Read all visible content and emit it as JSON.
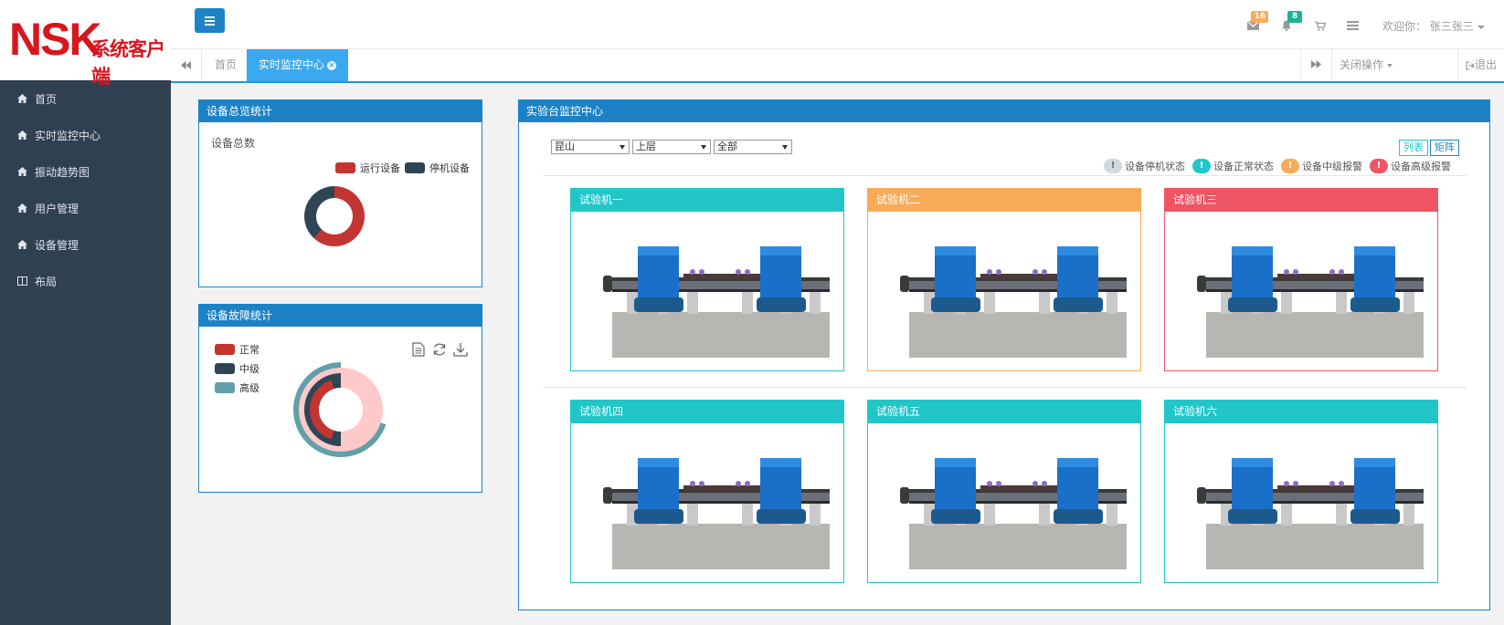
{
  "brand": {
    "logo_main": "NSK",
    "logo_sub": "系统客户端"
  },
  "sidebar": {
    "items": [
      {
        "label": "首页",
        "icon": "home-icon"
      },
      {
        "label": "实时监控中心",
        "icon": "home-icon"
      },
      {
        "label": "振动趋势图",
        "icon": "home-icon"
      },
      {
        "label": "用户管理",
        "icon": "home-icon"
      },
      {
        "label": "设备管理",
        "icon": "home-icon"
      },
      {
        "label": "布局",
        "icon": "layout-icon"
      }
    ]
  },
  "header": {
    "mail_count": "16",
    "notify_count": "8",
    "welcome": "欢迎你： 张三张三"
  },
  "tabs": {
    "items": [
      {
        "label": "首页"
      },
      {
        "label": "实时监控中心"
      }
    ],
    "close_ops": "关闭操作",
    "logout": "退出"
  },
  "overview": {
    "title": "设备总览统计",
    "total_label": "设备总数",
    "legend": [
      {
        "label": "运行设备",
        "color": "#c23531"
      },
      {
        "label": "停机设备",
        "color": "#2f4554"
      }
    ]
  },
  "fault": {
    "title": "设备故障统计",
    "legend": [
      {
        "label": "正常",
        "color": "#c23531"
      },
      {
        "label": "中级",
        "color": "#2f4554"
      },
      {
        "label": "高级",
        "color": "#61a0a8"
      }
    ]
  },
  "chart_data": [
    {
      "type": "pie",
      "categories": [
        "运行设备",
        "停机设备"
      ],
      "values": [
        62,
        38
      ],
      "colors": [
        "#c23531",
        "#2f4554"
      ]
    },
    {
      "type": "pie",
      "categories": [
        "正常",
        "中级",
        "高级"
      ],
      "values": [
        25,
        50,
        25
      ],
      "colors": [
        "#c23531",
        "#2f4554",
        "#61a0a8"
      ]
    }
  ],
  "monitor": {
    "title": "实验台监控中心",
    "filters": [
      "昆山",
      "上层",
      "全部"
    ],
    "view_list": "列表",
    "view_matrix": "矩阵",
    "status_legend": [
      {
        "label": "设备停机状态",
        "color": "#d1dade"
      },
      {
        "label": "设备正常状态",
        "color": "#23c6c8"
      },
      {
        "label": "设备中级报警",
        "color": "#f8ac59"
      },
      {
        "label": "设备高级报警",
        "color": "#ed5565"
      }
    ],
    "machines": [
      {
        "name": "试验机一",
        "color": "#23c6c8"
      },
      {
        "name": "试验机二",
        "color": "#f8ac59"
      },
      {
        "name": "试验机三",
        "color": "#ed5565"
      },
      {
        "name": "试验机四",
        "color": "#23c6c8"
      },
      {
        "name": "试验机五",
        "color": "#23c6c8"
      },
      {
        "name": "试验机六",
        "color": "#23c6c8"
      }
    ]
  }
}
